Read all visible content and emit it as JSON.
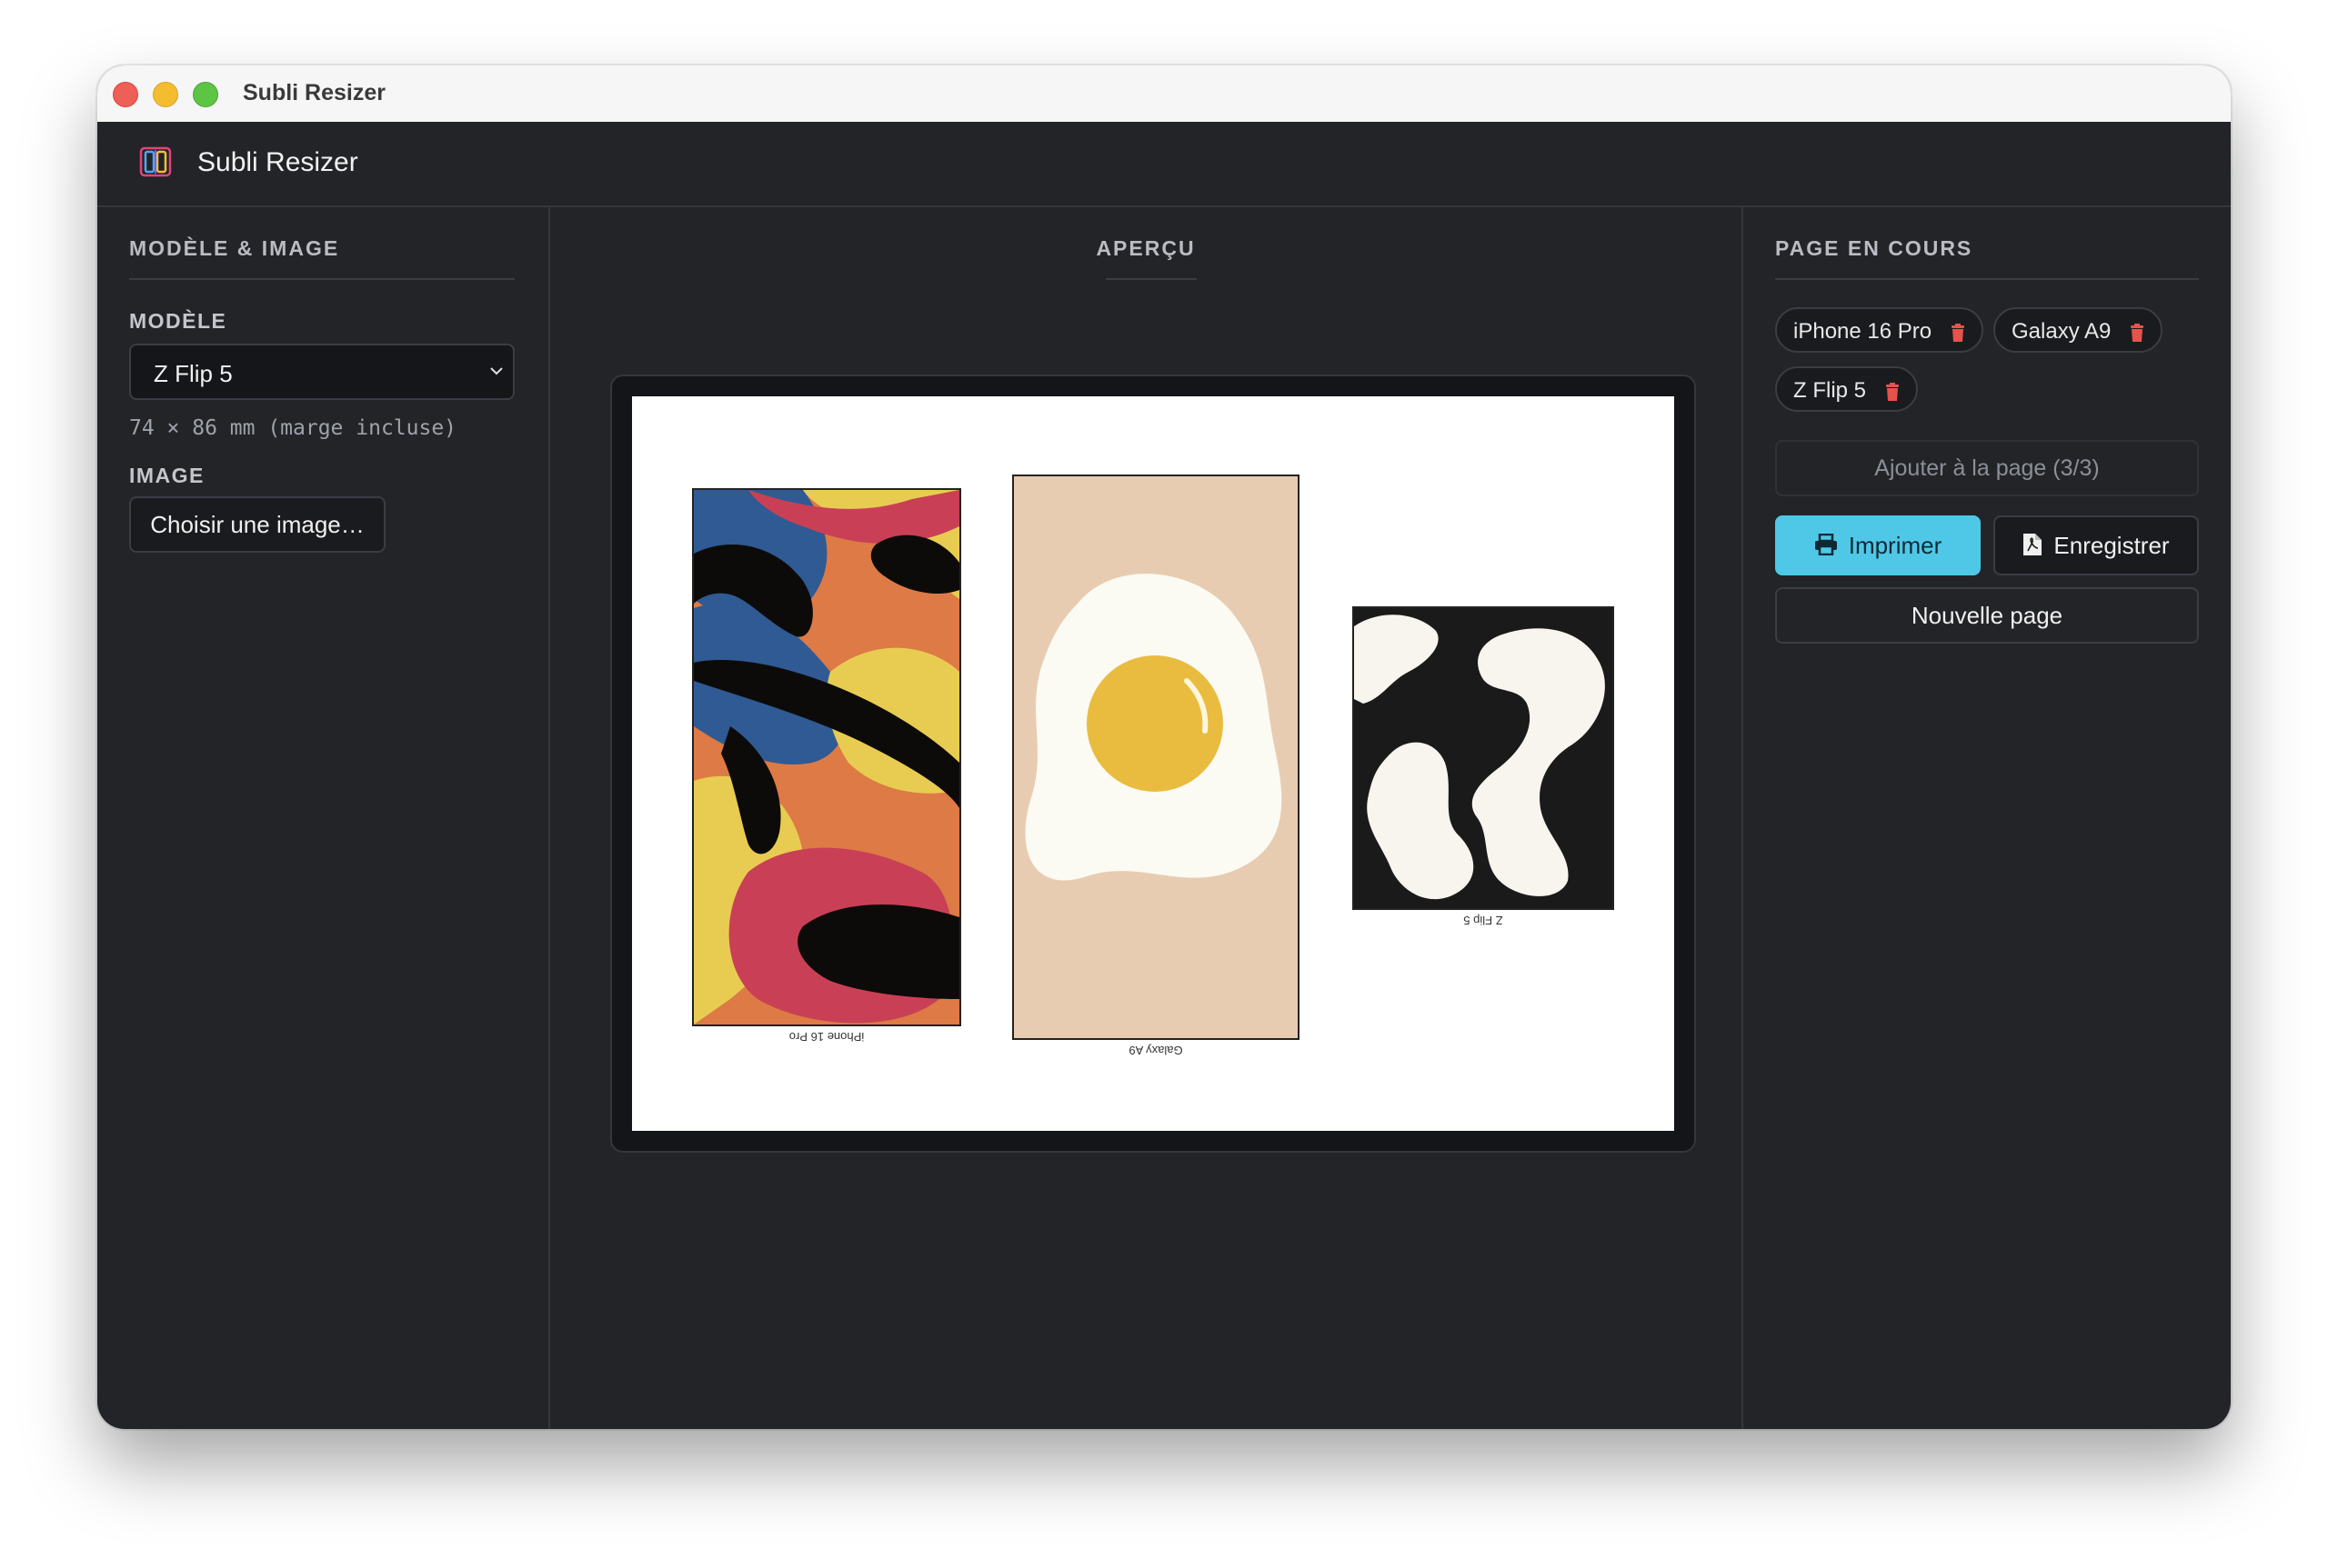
{
  "window": {
    "title": "Subli Resizer"
  },
  "header": {
    "app_name": "Subli Resizer"
  },
  "left": {
    "section_title": "MODÈLE & IMAGE",
    "model_label": "MODÈLE",
    "model_selected": "Z Flip 5",
    "dimensions": "74 × 86 mm (marge incluse)",
    "image_label": "IMAGE",
    "choose_image": "Choisir une image…"
  },
  "preview": {
    "title": "APERÇU",
    "cards": [
      {
        "label": "iPhone 16 Pro"
      },
      {
        "label": "Galaxy A9"
      },
      {
        "label": "Z Flip 5"
      }
    ]
  },
  "right": {
    "section_title": "PAGE EN COURS",
    "chips": [
      "iPhone 16 Pro",
      "Galaxy A9",
      "Z Flip 5"
    ],
    "add_to_page": "Ajouter à la page (3/3)",
    "print": "Imprimer",
    "save": "Enregistrer",
    "new_page": "Nouvelle page"
  },
  "colors": {
    "accent": "#4fc8e8",
    "delete": "#e5534b",
    "background": "#232428"
  }
}
